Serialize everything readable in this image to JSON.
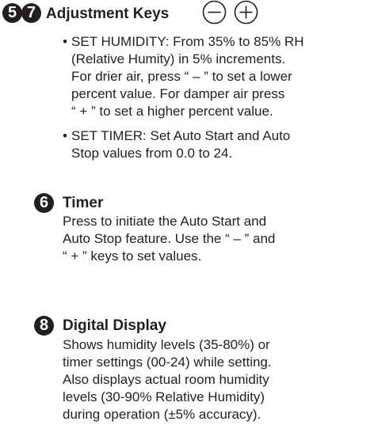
{
  "adjustment": {
    "badges": [
      "5",
      "7"
    ],
    "title": "Adjustment Keys",
    "minus_symbol": "–",
    "plus_symbol": "+",
    "bullets": [
      {
        "lines": [
          "SET HUMIDITY: From 35% to 85% RH",
          "(Relative Humity) in 5% increments.",
          "For drier air, press “ – ” to set a lower",
          "percent value. For damper air press",
          "“ + ” to set a higher percent value."
        ]
      },
      {
        "lines": [
          "SET TIMER: Set Auto Start and Auto",
          "Stop values from 0.0 to 24."
        ]
      }
    ]
  },
  "timer": {
    "badge": "6",
    "title": "Timer",
    "lines": [
      "Press to initiate the Auto Start and",
      "Auto Stop feature. Use the “ – ” and",
      "“ + ” keys to set values."
    ]
  },
  "display": {
    "badge": "8",
    "title": "Digital Display",
    "lines": [
      "Shows humidity levels (35-80%) or",
      "timer settings (00-24) while setting.",
      "Also displays actual room humidity",
      "levels (30-90% Relative Humidity)",
      "during operation (±5% accuracy)."
    ]
  }
}
